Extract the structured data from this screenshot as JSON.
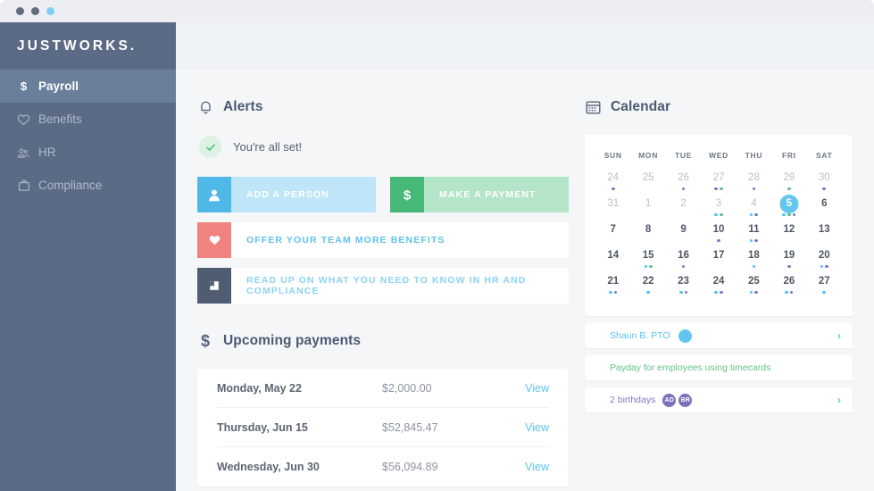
{
  "window": {
    "dots": [
      "dot-dark",
      "dot-dark",
      "dot-blue"
    ]
  },
  "sidebar": {
    "brand": "JUSTWORKS.",
    "items": [
      {
        "label": "Payroll",
        "icon": "dollar-icon",
        "active": true
      },
      {
        "label": "Benefits",
        "icon": "heart-icon",
        "active": false
      },
      {
        "label": "HR",
        "icon": "people-icon",
        "active": false
      },
      {
        "label": "Compliance",
        "icon": "briefcase-icon",
        "active": false
      }
    ]
  },
  "alerts": {
    "title": "Alerts",
    "icon": "bell-icon",
    "status_text": "You're all set!",
    "status_icon": "check-circle-icon",
    "primary_actions": [
      {
        "label": "ADD A PERSON",
        "icon": "person-icon",
        "accent": "#4fb8e9"
      },
      {
        "label": "MAKE A PAYMENT",
        "icon": "dollar-icon",
        "accent": "#46b878"
      }
    ],
    "secondary_actions": [
      {
        "label": "OFFER YOUR TEAM MORE BENEFITS",
        "icon": "heart-icon",
        "accent": "#f0827f"
      },
      {
        "label": "READ UP ON WHAT YOU NEED TO KNOW IN HR AND COMPLIANCE",
        "icon": "book-icon",
        "accent": "#4f5c72"
      }
    ]
  },
  "payments": {
    "title": "Upcoming payments",
    "icon": "dollar-icon",
    "rows": [
      {
        "date": "Monday, May 22",
        "amount": "$2,000.00",
        "action": "View"
      },
      {
        "date": "Thursday, Jun 15",
        "amount": "$52,845.47",
        "action": "View"
      },
      {
        "date": "Wednesday, Jun 30",
        "amount": "$56,094.89",
        "action": "View"
      }
    ]
  },
  "calendar": {
    "title": "Calendar",
    "icon": "calendar-icon",
    "dow": [
      "SUN",
      "MON",
      "TUE",
      "WED",
      "THU",
      "FRI",
      "SAT"
    ],
    "selected_day": 5,
    "dot_colors": {
      "purple": "#8377c4",
      "green": "#61c08b",
      "cyan": "#51c4ef",
      "white": "#ffffff"
    },
    "weeks": [
      [
        {
          "n": "24",
          "muted": true,
          "dots": [
            "purple"
          ]
        },
        {
          "n": "25",
          "muted": true,
          "dots": []
        },
        {
          "n": "26",
          "muted": true,
          "dots": [
            "purple"
          ]
        },
        {
          "n": "27",
          "muted": true,
          "dots": [
            "purple",
            "green"
          ]
        },
        {
          "n": "28",
          "muted": true,
          "dots": [
            "purple"
          ]
        },
        {
          "n": "29",
          "muted": true,
          "dots": [
            "green"
          ]
        },
        {
          "n": "30",
          "muted": true,
          "dots": [
            "purple"
          ]
        }
      ],
      [
        {
          "n": "31",
          "muted": true,
          "dots": []
        },
        {
          "n": "1",
          "muted": true,
          "dots": []
        },
        {
          "n": "2",
          "muted": true,
          "dots": []
        },
        {
          "n": "3",
          "muted": true,
          "dots": [
            "cyan",
            "green"
          ]
        },
        {
          "n": "4",
          "muted": true,
          "dots": [
            "cyan",
            "purple"
          ]
        },
        {
          "n": "5",
          "muted": false,
          "selected": true,
          "dots": [
            "cyan",
            "green",
            "purple"
          ]
        },
        {
          "n": "6",
          "muted": false,
          "dots": []
        }
      ],
      [
        {
          "n": "7",
          "muted": false,
          "dots": []
        },
        {
          "n": "8",
          "muted": false,
          "dots": []
        },
        {
          "n": "9",
          "muted": false,
          "dots": []
        },
        {
          "n": "10",
          "muted": false,
          "dots": [
            "purple"
          ]
        },
        {
          "n": "11",
          "muted": false,
          "dots": [
            "cyan",
            "purple"
          ]
        },
        {
          "n": "12",
          "muted": false,
          "dots": []
        },
        {
          "n": "13",
          "muted": false,
          "dots": []
        }
      ],
      [
        {
          "n": "14",
          "muted": false,
          "dots": []
        },
        {
          "n": "15",
          "muted": false,
          "dots": [
            "cyan",
            "green"
          ]
        },
        {
          "n": "16",
          "muted": false,
          "dots": [
            "purple"
          ]
        },
        {
          "n": "17",
          "muted": false,
          "dots": []
        },
        {
          "n": "18",
          "muted": false,
          "dots": [
            "cyan"
          ]
        },
        {
          "n": "19",
          "muted": false,
          "dots": [
            "purple"
          ]
        },
        {
          "n": "20",
          "muted": false,
          "dots": [
            "cyan",
            "purple"
          ]
        }
      ],
      [
        {
          "n": "21",
          "muted": false,
          "dots": [
            "cyan",
            "purple"
          ]
        },
        {
          "n": "22",
          "muted": false,
          "dots": [
            "cyan"
          ]
        },
        {
          "n": "23",
          "muted": false,
          "dots": [
            "cyan",
            "purple"
          ]
        },
        {
          "n": "24",
          "muted": false,
          "dots": [
            "cyan",
            "purple"
          ]
        },
        {
          "n": "25",
          "muted": false,
          "dots": [
            "cyan",
            "purple"
          ]
        },
        {
          "n": "26",
          "muted": false,
          "dots": [
            "cyan",
            "purple"
          ]
        },
        {
          "n": "27",
          "muted": false,
          "dots": [
            "cyan"
          ]
        }
      ]
    ],
    "events": [
      {
        "kind": "pto",
        "label": "Shaun B. PTO",
        "avatar_blue": true,
        "chevron": "›"
      },
      {
        "kind": "payday",
        "label": "Payday for employees using timecards"
      },
      {
        "kind": "bday",
        "label": "2 birthdays",
        "avatars": [
          "AD",
          "BR"
        ],
        "chevron": "›"
      }
    ]
  }
}
